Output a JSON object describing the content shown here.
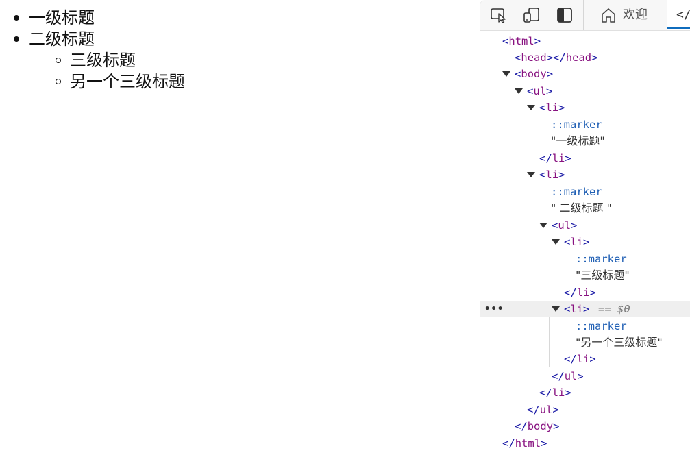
{
  "rendered_page": {
    "items": [
      {
        "text": "一级标题"
      },
      {
        "text": "二级标题"
      },
      {
        "text": "三级标题"
      },
      {
        "text": "另一个三级标题"
      }
    ]
  },
  "devtools": {
    "toolbar": {
      "inspect_icon": "inspect-element-icon",
      "device_icon": "device-emulation-icon",
      "sidebar_icon": "dock-sidebar-icon",
      "welcome_tab_label": "欢迎",
      "elements_tab_label": "</"
    },
    "tree": {
      "html_open": "<html>",
      "head": "<head></head>",
      "body_open": "<body>",
      "ul_open": "<ul>",
      "li_open": "<li>",
      "marker": "::marker",
      "text_1": "\"一级标题\"",
      "li_close": "</li>",
      "text_2": "\" 二级标题 \"",
      "text_3": "\"三级标题\"",
      "selected_suffix": "== $0",
      "text_4": "\"另一个三级标题\"",
      "ul_close": "</ul>",
      "body_close": "</body>",
      "html_close": "</html>",
      "more_dots": "•••"
    }
  },
  "colors": {
    "tag": "#881280",
    "pseudo": "#1f5fb4",
    "accent": "#0f6cbd"
  }
}
